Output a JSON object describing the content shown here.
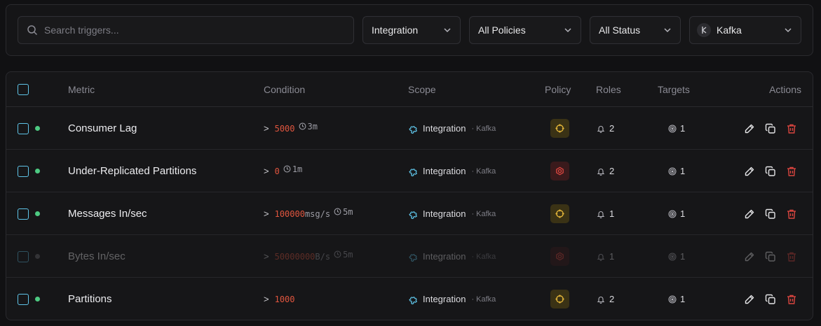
{
  "filters": {
    "search_placeholder": "Search triggers...",
    "integration_label": "Integration",
    "policies_label": "All Policies",
    "status_label": "All Status",
    "kafka_label": "Kafka"
  },
  "table": {
    "headers": {
      "metric": "Metric",
      "condition": "Condition",
      "scope": "Scope",
      "policy": "Policy",
      "roles": "Roles",
      "targets": "Targets",
      "actions": "Actions"
    },
    "rows": [
      {
        "metric": "Consumer Lag",
        "op": ">",
        "value": "5000",
        "unit": "",
        "duration": "3m",
        "scope": "Integration",
        "scope_sub": "· Kafka",
        "policy": "warning",
        "roles": "2",
        "targets": "1",
        "enabled": true
      },
      {
        "metric": "Under-Replicated Partitions",
        "op": ">",
        "value": "0",
        "unit": "",
        "duration": "1m",
        "scope": "Integration",
        "scope_sub": "· Kafka",
        "policy": "critical",
        "roles": "2",
        "targets": "1",
        "enabled": true
      },
      {
        "metric": "Messages In/sec",
        "op": ">",
        "value": "100000",
        "unit": "msg/s",
        "duration": "5m",
        "scope": "Integration",
        "scope_sub": "· Kafka",
        "policy": "warning",
        "roles": "1",
        "targets": "1",
        "enabled": true
      },
      {
        "metric": "Bytes In/sec",
        "op": ">",
        "value": "50000000",
        "unit": "B/s",
        "duration": "5m",
        "scope": "Integration",
        "scope_sub": "· Kafka",
        "policy": "critical",
        "roles": "1",
        "targets": "1",
        "enabled": false
      },
      {
        "metric": "Partitions",
        "op": ">",
        "value": "1000",
        "unit": "",
        "duration": "",
        "scope": "Integration",
        "scope_sub": "· Kafka",
        "policy": "warning",
        "roles": "2",
        "targets": "1",
        "enabled": true
      }
    ]
  },
  "colors": {
    "accent": "#5fc4e8",
    "enabled_dot": "#4dca82",
    "condition_value": "#e0553e",
    "warning": "#e8b93a",
    "critical": "#d9453f",
    "delete": "#d9453f"
  },
  "icons": {
    "search": "search-icon",
    "chevron": "chevron-down-icon",
    "scope": "puzzle-icon",
    "warning_policy": "crosshair-icon",
    "critical_policy": "target-icon",
    "roles": "bell-icon",
    "targets": "target-dot-icon",
    "edit": "pencil-icon",
    "duplicate": "copy-icon",
    "delete": "trash-icon",
    "duration": "clock-icon"
  }
}
